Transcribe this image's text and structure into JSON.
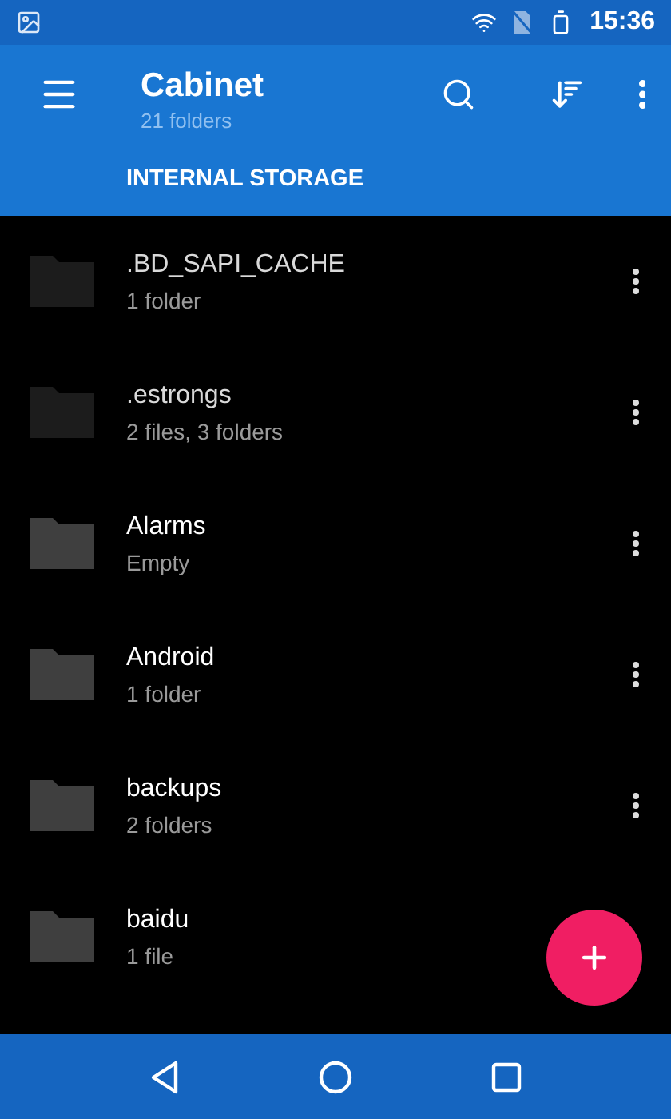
{
  "status_bar": {
    "time": "15:36"
  },
  "app_bar": {
    "title": "Cabinet",
    "subtitle": "21 folders",
    "location": "INTERNAL STORAGE"
  },
  "folders": [
    {
      "name": ".BD_SAPI_CACHE",
      "info": "1 folder",
      "hidden": true,
      "menu": true
    },
    {
      "name": ".estrongs",
      "info": "2 files, 3 folders",
      "hidden": true,
      "menu": true
    },
    {
      "name": "Alarms",
      "info": "Empty",
      "hidden": false,
      "menu": true
    },
    {
      "name": "Android",
      "info": "1 folder",
      "hidden": false,
      "menu": true
    },
    {
      "name": "backups",
      "info": "2 folders",
      "hidden": false,
      "menu": true
    },
    {
      "name": "baidu",
      "info": "1 file",
      "hidden": false,
      "menu": false
    }
  ]
}
